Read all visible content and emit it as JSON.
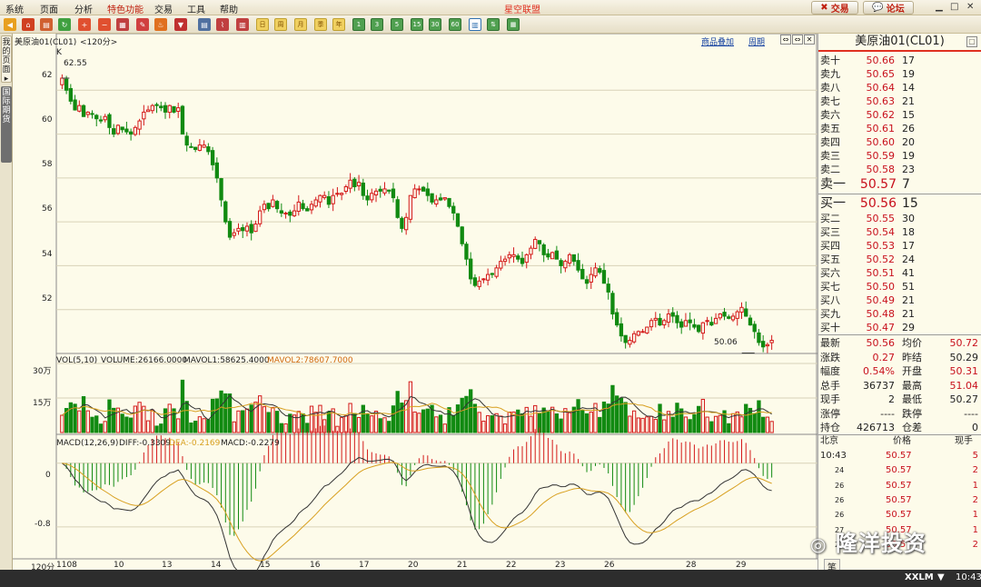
{
  "menu": [
    "系统",
    "页面",
    "分析",
    "特色功能",
    "交易",
    "工具",
    "帮助"
  ],
  "app_title": "星空联盟",
  "trade_button": "交易",
  "forum_button": "论坛",
  "toolbar_labels": [
    "日",
    "周",
    "月",
    "季",
    "年",
    "1",
    "3",
    "5",
    "15",
    "30",
    "60"
  ],
  "side_tabs": [
    "我的页面",
    "国际期货"
  ],
  "chart_header": {
    "symbol": "美原油01(CL01)",
    "period": "<120分>",
    "tag": "K",
    "overlay_btn": "商品叠加",
    "cycle_btn": "周期"
  },
  "chart_data": [
    {
      "type": "candlestick",
      "title": "美原油01(CL01)",
      "period_label": "120分",
      "y_ticks": [
        "62",
        "60",
        "58",
        "56",
        "54",
        "52"
      ],
      "ylim": [
        50.0,
        64.0
      ],
      "x_date_labels": [
        "1108",
        "10",
        "13",
        "14",
        "15",
        "16",
        "17",
        "20",
        "21",
        "22",
        "23",
        "26",
        "28",
        "29"
      ],
      "high_label": "62.55",
      "low_label": "50.06",
      "closes": [
        62.55,
        62.0,
        61.5,
        61.1,
        61.3,
        60.8,
        61.0,
        60.9,
        60.7,
        60.6,
        60.8,
        60.3,
        60.0,
        60.4,
        60.2,
        60.1,
        60.0,
        60.3,
        60.6,
        61.0,
        61.1,
        61.3,
        61.3,
        61.2,
        61.0,
        61.3,
        61.0,
        61.2,
        60.0,
        59.5,
        59.4,
        59.3,
        59.5,
        59.5,
        59.2,
        58.6,
        58.0,
        57.0,
        56.0,
        55.3,
        55.5,
        55.7,
        55.6,
        55.8,
        55.5,
        55.9,
        56.5,
        56.8,
        56.6,
        57.0,
        56.6,
        56.4,
        56.4,
        56.3,
        56.5,
        56.9,
        56.6,
        56.5,
        56.8,
        57.0,
        57.2,
        57.2,
        56.8,
        57.2,
        57.3,
        57.3,
        57.6,
        57.9,
        57.6,
        57.8,
        57.2,
        57.0,
        57.3,
        57.4,
        57.4,
        57.5,
        57.4,
        57.1,
        56.2,
        55.7,
        56.2,
        57.2,
        57.5,
        57.5,
        57.4,
        57.2,
        56.9,
        57.0,
        57.0,
        57.1,
        56.7,
        56.4,
        55.8,
        55.0,
        54.3,
        53.4,
        53.1,
        53.3,
        53.4,
        53.6,
        53.6,
        53.9,
        54.2,
        54.3,
        54.5,
        54.5,
        54.3,
        54.1,
        54.5,
        54.8,
        55.2,
        55.0,
        54.5,
        54.4,
        54.6,
        54.3,
        54.0,
        54.2,
        54.5,
        54.2,
        53.8,
        53.4,
        53.2,
        53.6,
        53.9,
        53.7,
        53.2,
        52.8,
        51.8,
        51.3,
        50.8,
        50.5,
        50.6,
        50.9,
        51.0,
        51.0,
        51.2,
        51.5,
        51.6,
        51.3,
        51.5,
        51.8,
        51.7,
        51.4,
        51.2,
        51.5,
        51.4,
        51.2,
        51.0,
        51.4,
        51.5,
        51.3,
        51.6,
        51.8,
        51.7,
        51.6,
        51.7,
        51.9,
        52.1,
        51.7,
        51.3,
        51.0,
        50.5,
        50.3,
        50.4,
        50.6
      ]
    },
    {
      "type": "bar",
      "title": "VOL(5,10)",
      "volume": "VOLUME:26166.0000",
      "mavol1": "MAVOL1:58625.4000",
      "mavol2": "MAVOL2:78607.7000",
      "y_ticks": [
        "30万",
        "15万"
      ],
      "ylim": [
        0,
        300000
      ]
    },
    {
      "type": "line",
      "title": "MACD(12,26,9)",
      "diff": "DIFF:-0.3309",
      "dea": "DEA:-0.2169",
      "macd": "MACD:-0.2279",
      "y_ticks": [
        "0",
        "-0.8"
      ],
      "ylim": [
        -1.2,
        0.35
      ]
    }
  ],
  "quote": {
    "title": "美原油01(CL01)",
    "asks": [
      {
        "label": "卖十",
        "price": "50.66",
        "vol": "17"
      },
      {
        "label": "卖九",
        "price": "50.65",
        "vol": "19"
      },
      {
        "label": "卖八",
        "price": "50.64",
        "vol": "14"
      },
      {
        "label": "卖七",
        "price": "50.63",
        "vol": "21"
      },
      {
        "label": "卖六",
        "price": "50.62",
        "vol": "15"
      },
      {
        "label": "卖五",
        "price": "50.61",
        "vol": "26"
      },
      {
        "label": "卖四",
        "price": "50.60",
        "vol": "20"
      },
      {
        "label": "卖三",
        "price": "50.59",
        "vol": "19"
      },
      {
        "label": "卖二",
        "price": "50.58",
        "vol": "23"
      },
      {
        "label": "卖一",
        "price": "50.57",
        "vol": "7"
      }
    ],
    "bids": [
      {
        "label": "买一",
        "price": "50.56",
        "vol": "15"
      },
      {
        "label": "买二",
        "price": "50.55",
        "vol": "30"
      },
      {
        "label": "买三",
        "price": "50.54",
        "vol": "18"
      },
      {
        "label": "买四",
        "price": "50.53",
        "vol": "17"
      },
      {
        "label": "买五",
        "price": "50.52",
        "vol": "24"
      },
      {
        "label": "买六",
        "price": "50.51",
        "vol": "41"
      },
      {
        "label": "买七",
        "price": "50.50",
        "vol": "51"
      },
      {
        "label": "买八",
        "price": "50.49",
        "vol": "21"
      },
      {
        "label": "买九",
        "price": "50.48",
        "vol": "21"
      },
      {
        "label": "买十",
        "price": "50.47",
        "vol": "29"
      }
    ],
    "stats": [
      {
        "l1": "最新",
        "v1": "50.56",
        "l2": "均价",
        "v2": "50.72"
      },
      {
        "l1": "涨跌",
        "v1": "0.27",
        "l2": "昨结",
        "v2": "50.29"
      },
      {
        "l1": "幅度",
        "v1": "0.54%",
        "l2": "开盘",
        "v2": "50.31"
      },
      {
        "l1": "总手",
        "v1": "36737",
        "l2": "最高",
        "v2": "51.04"
      },
      {
        "l1": "现手",
        "v1": "2",
        "l2": "最低",
        "v2": "50.27"
      },
      {
        "l1": "涨停",
        "v1": "----",
        "l2": "跌停",
        "v2": "----"
      },
      {
        "l1": "持仓",
        "v1": "426713",
        "l2": "仓差",
        "v2": "0"
      }
    ],
    "ticks_header": {
      "c1": "北京",
      "c2": "价格",
      "c3": "现手"
    },
    "ticks": [
      {
        "t": "10:43",
        "p": "50.57",
        "v": "5"
      },
      {
        "t": "24",
        "p": "50.57",
        "v": "2"
      },
      {
        "t": "26",
        "p": "50.57",
        "v": "1"
      },
      {
        "t": "26",
        "p": "50.57",
        "v": "2"
      },
      {
        "t": "26",
        "p": "50.57",
        "v": "1"
      },
      {
        "t": "27",
        "p": "50.57",
        "v": "1"
      },
      {
        "t": "27",
        "p": "50.57",
        "v": "2"
      }
    ],
    "bottom_tab": "笔"
  },
  "watermark": "隆洋投资",
  "status": {
    "brand": "XXLM",
    "time": "10:43"
  },
  "colors": {
    "up": "#d41a1a",
    "down": "#118a11",
    "diff_line": "#333333",
    "dea_line": "#d8a020"
  }
}
